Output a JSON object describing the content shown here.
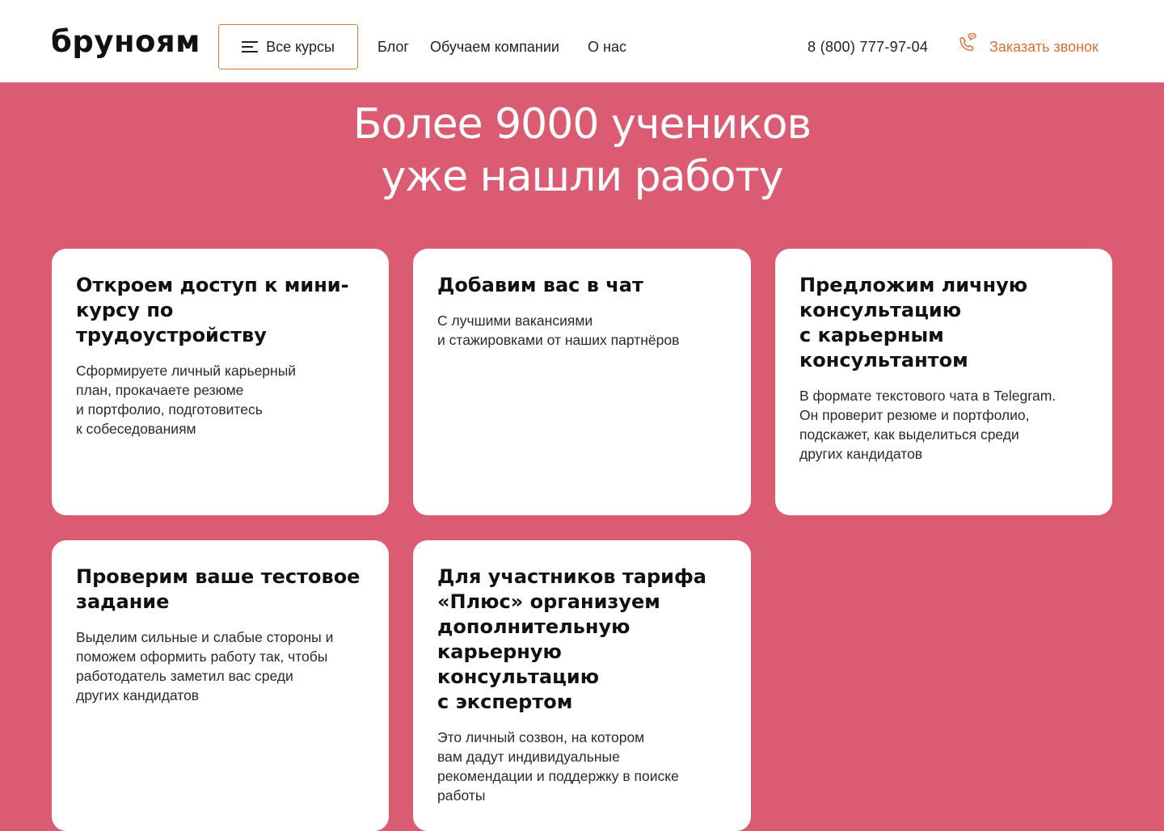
{
  "header": {
    "logo": "бруноям",
    "courses_button": "Все курсы",
    "nav": [
      "Блог",
      "Обучаем компании",
      "О нас"
    ],
    "phone": "8 (800) 777-97-04",
    "call_label": "Заказать звонок"
  },
  "hero": {
    "title": "Более 9000 учеников\nуже нашли работу"
  },
  "cards": [
    {
      "title": "Откроем доступ к мини-\nкурсу по трудоустройству",
      "text": "Сформируете личный карьерный\nплан, прокачаете резюме\nи портфолио, подготовитесь\nк собеседованиям"
    },
    {
      "title": "Добавим вас в чат",
      "text": "С лучшими вакансиями\nи стажировками от наших партнёров"
    },
    {
      "title": "Предложим личную\nконсультацию\nс карьерным\nконсультантом",
      "text": "В формате текстового чата в Telegram.\nОн проверит резюме и портфолио,\nподскажет, как выделиться среди\nдругих кандидатов"
    },
    {
      "title": "Проверим ваше тестовое\nзадание",
      "text": "Выделим сильные и слабые стороны и\nпоможем оформить работу так, чтобы\nработодатель заметил вас среди\nдругих кандидатов"
    },
    {
      "title": "Для участников тарифа\n«Плюс» организуем\nдополнительную\nкарьерную консультацию\nс экспертом",
      "text": "Это личный созвон, на котором\nвам дадут индивидуальные\nрекомендации и поддержку в поиске\nработы"
    }
  ],
  "colors": {
    "background": "#db5c72",
    "accent": "#d86f33",
    "card": "#ffffff"
  },
  "icons": {
    "menu": "burger-menu-icon",
    "call": "phone-chat-icon"
  }
}
